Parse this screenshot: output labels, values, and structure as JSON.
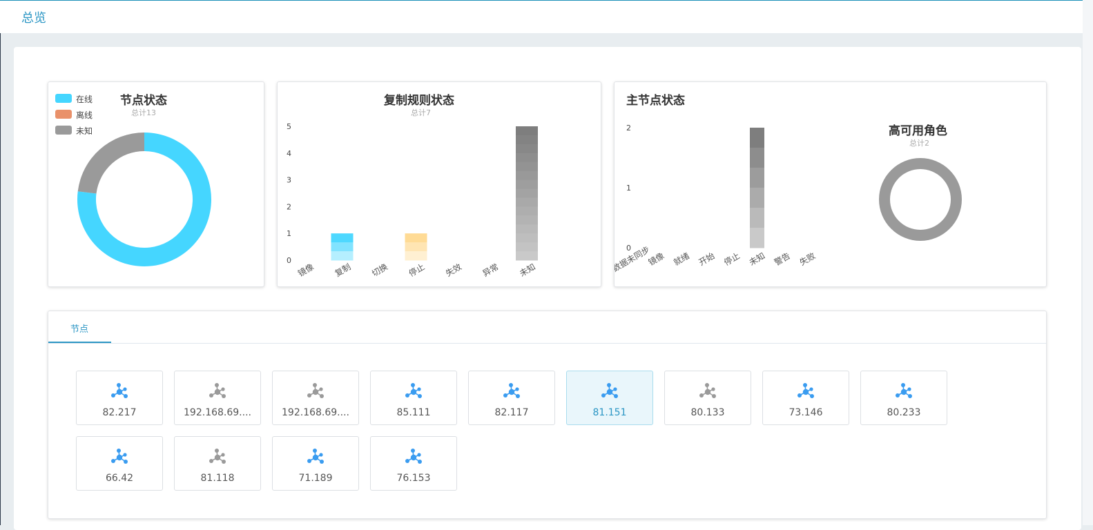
{
  "header": {
    "title": "总览"
  },
  "node_status": {
    "title": "节点状态",
    "total": "总计13",
    "legend": [
      {
        "label": "在线",
        "color": "#45d6ff"
      },
      {
        "label": "离线",
        "color": "#e9916a"
      },
      {
        "label": "未知",
        "color": "#9a9a9a"
      }
    ]
  },
  "replication": {
    "title": "复制规则状态",
    "total": "总计7"
  },
  "master": {
    "title": "主节点状态"
  },
  "ha": {
    "title": "高可用角色",
    "total": "总计2"
  },
  "chart_data": [
    {
      "type": "pie",
      "title": "节点状态",
      "subtitle": "总计13",
      "slices": [
        {
          "label": "在线",
          "value": 10,
          "color": "#45d6ff"
        },
        {
          "label": "离线",
          "value": 0,
          "color": "#e9916a"
        },
        {
          "label": "未知",
          "value": 3,
          "color": "#9a9a9a"
        }
      ],
      "legend": "top-left"
    },
    {
      "type": "bar",
      "title": "复制规则状态",
      "subtitle": "总计7",
      "categories": [
        "镜像",
        "复制",
        "切换",
        "停止",
        "失效",
        "异常",
        "未知"
      ],
      "values": [
        0,
        1,
        0,
        1,
        0,
        0,
        5
      ],
      "colors": [
        "#45d6ff",
        "#45d6ff",
        "#45d6ff",
        "#ffd98f",
        "#9a9a9a",
        "#9a9a9a",
        "#777777"
      ],
      "yticks": [
        0,
        1,
        2,
        3,
        4,
        5
      ],
      "ylim": [
        0,
        5
      ]
    },
    {
      "type": "bar",
      "title": "主节点状态",
      "categories": [
        "数据未同步",
        "镜像",
        "就绪",
        "开始",
        "停止",
        "未知",
        "警告",
        "失败"
      ],
      "values": [
        0,
        0,
        0,
        0,
        0,
        2,
        0,
        0
      ],
      "colors": [
        "#9a9a9a",
        "#9a9a9a",
        "#9a9a9a",
        "#9a9a9a",
        "#9a9a9a",
        "#777777",
        "#9a9a9a",
        "#9a9a9a"
      ],
      "yticks": [
        0,
        1,
        2
      ],
      "ylim": [
        0,
        2
      ]
    },
    {
      "type": "pie",
      "title": "高可用角色",
      "subtitle": "总计2",
      "slices": [
        {
          "label": "未知",
          "value": 2,
          "color": "#9a9a9a"
        }
      ]
    }
  ],
  "tabs": [
    {
      "label": "节点",
      "active": true
    }
  ],
  "nodes": [
    {
      "label": "82.217",
      "status": "online"
    },
    {
      "label": "192.168.69....",
      "status": "unknown"
    },
    {
      "label": "192.168.69....",
      "status": "unknown"
    },
    {
      "label": "85.111",
      "status": "online"
    },
    {
      "label": "82.117",
      "status": "online"
    },
    {
      "label": "81.151",
      "status": "online",
      "selected": true
    },
    {
      "label": "80.133",
      "status": "unknown"
    },
    {
      "label": "73.146",
      "status": "online"
    },
    {
      "label": "80.233",
      "status": "online"
    },
    {
      "label": "66.42",
      "status": "online"
    },
    {
      "label": "81.118",
      "status": "unknown"
    },
    {
      "label": "71.189",
      "status": "online"
    },
    {
      "label": "76.153",
      "status": "online"
    }
  ],
  "icon_colors": {
    "online": "#3a9cf0",
    "unknown": "#9a9a9a"
  }
}
